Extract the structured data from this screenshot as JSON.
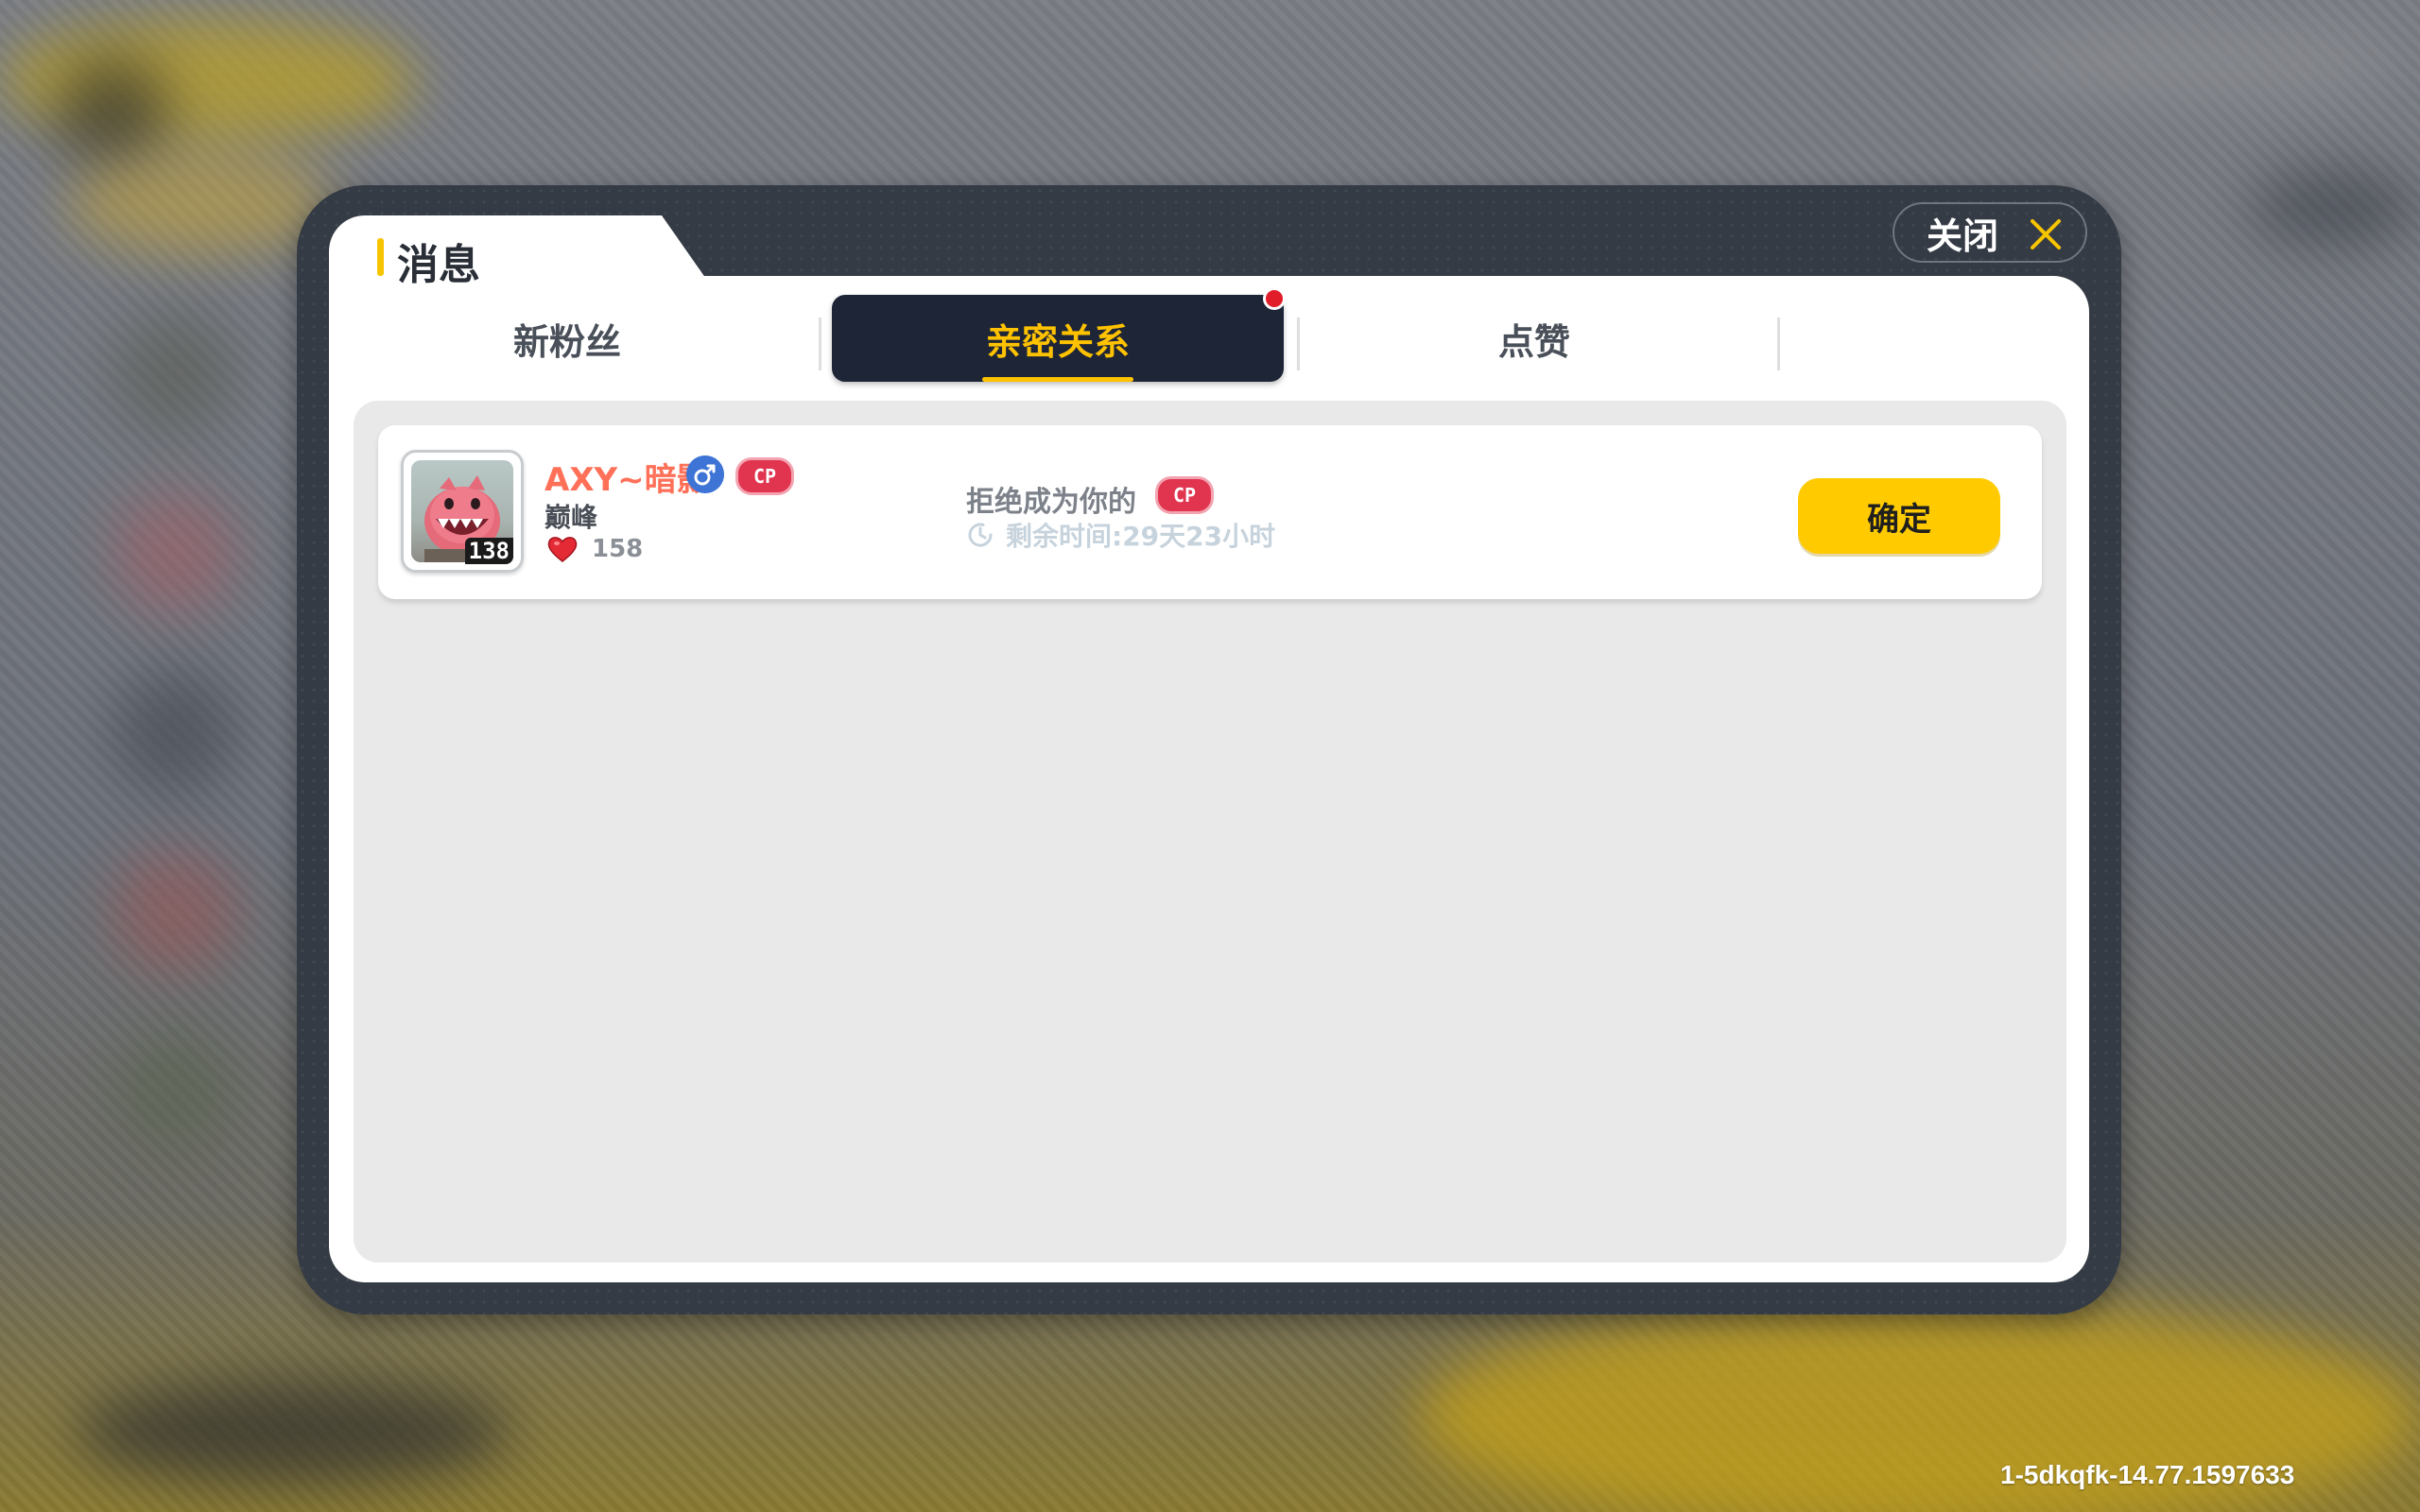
{
  "dialog": {
    "title": "消息",
    "close_label": "关闭"
  },
  "tabs": [
    {
      "label": "新粉丝",
      "active": false,
      "badge": false
    },
    {
      "label": "亲密关系",
      "active": true,
      "badge": true
    },
    {
      "label": "点赞",
      "active": false,
      "badge": false
    }
  ],
  "notifications": [
    {
      "username": "AXY~暗影",
      "gender_icon": "male-icon",
      "relation_badge": "CP",
      "avatar_level": "138",
      "rank": "巅峰",
      "likes": "158",
      "message": "拒绝成为你的",
      "message_badge": "CP",
      "remaining_time": "剩余时间:29天23小时",
      "action_label": "确定"
    }
  ],
  "footer": {
    "build_id": "1-5dkqfk-14.77.1597633"
  },
  "colors": {
    "accent_yellow": "#ffcb00",
    "active_tab_bg": "#1d2537",
    "username_color": "#ff7058",
    "cp_badge": "#e0344f"
  }
}
